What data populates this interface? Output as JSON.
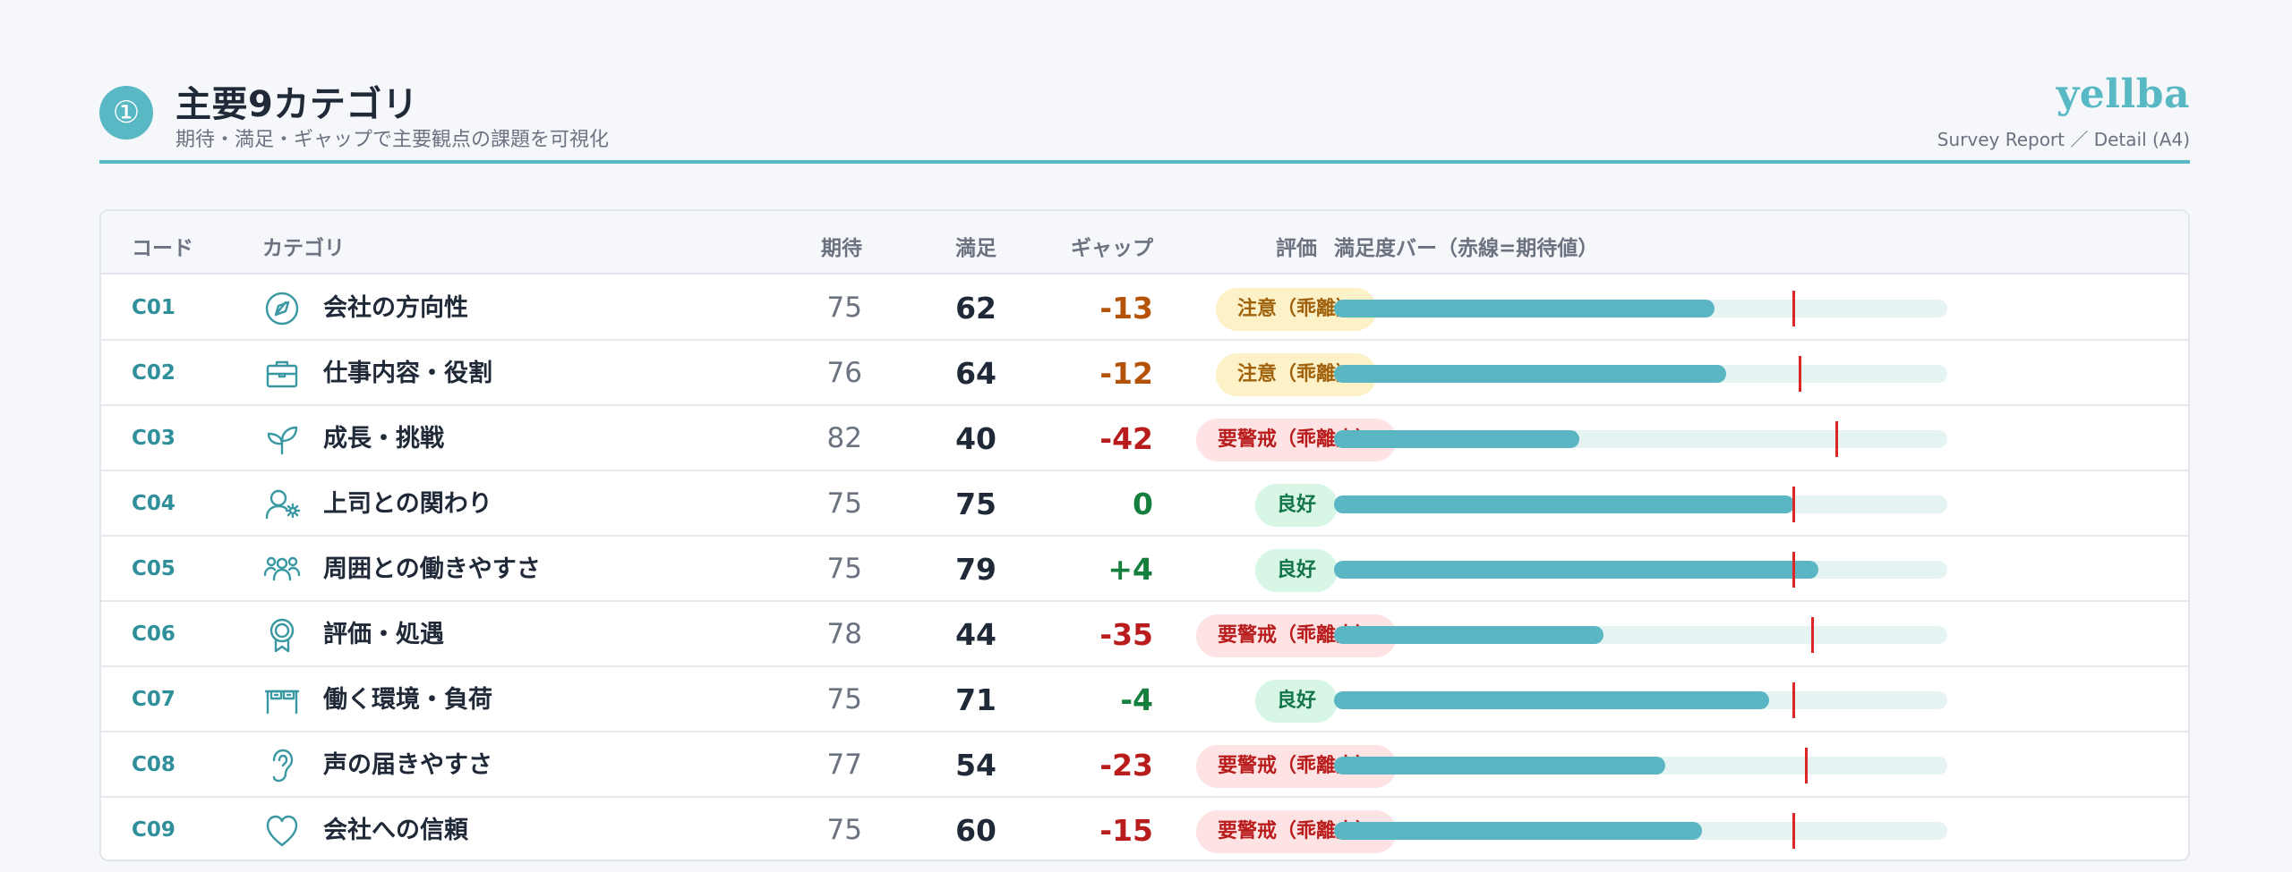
{
  "header": {
    "badge": "①",
    "title": "主要9カテゴリ",
    "subtitle": "期待・満足・ギャップで主要観点の課題を可視化",
    "brand": "yellba",
    "report_meta": "Survey Report ／ Detail (A4)"
  },
  "table": {
    "columns": {
      "code": "コード",
      "category": "カテゴリ",
      "expectation": "期待",
      "satisfaction": "満足",
      "gap": "ギャップ",
      "rating": "評価",
      "bar": "満足度バー（赤線=期待値）"
    },
    "rows": [
      {
        "code": "C01",
        "icon": "compass-icon",
        "category": "会社の方向性",
        "expectation": "75",
        "satisfaction": "62",
        "gap": "-13",
        "gap_color": "#b45309",
        "rating": "注意（乖離）",
        "rating_level": "warn",
        "satisfaction_pct": 62,
        "expectation_pct": 75
      },
      {
        "code": "C02",
        "icon": "briefcase-icon",
        "category": "仕事内容・役割",
        "expectation": "76",
        "satisfaction": "64",
        "gap": "-12",
        "gap_color": "#b45309",
        "rating": "注意（乖離）",
        "rating_level": "warn",
        "satisfaction_pct": 64,
        "expectation_pct": 76
      },
      {
        "code": "C03",
        "icon": "sprout-icon",
        "category": "成長・挑戦",
        "expectation": "82",
        "satisfaction": "40",
        "gap": "-42",
        "gap_color": "#b91c1c",
        "rating": "要警戒（乖離大）",
        "rating_level": "danger",
        "satisfaction_pct": 40,
        "expectation_pct": 82
      },
      {
        "code": "C04",
        "icon": "user-gear-icon",
        "category": "上司との関わり",
        "expectation": "75",
        "satisfaction": "75",
        "gap": "0",
        "gap_color": "#15803d",
        "rating": "良好",
        "rating_level": "good",
        "satisfaction_pct": 75,
        "expectation_pct": 75
      },
      {
        "code": "C05",
        "icon": "team-icon",
        "category": "周囲との働きやすさ",
        "expectation": "75",
        "satisfaction": "79",
        "gap": "+4",
        "gap_color": "#15803d",
        "rating": "良好",
        "rating_level": "good",
        "satisfaction_pct": 79,
        "expectation_pct": 75
      },
      {
        "code": "C06",
        "icon": "award-icon",
        "category": "評価・処遇",
        "expectation": "78",
        "satisfaction": "44",
        "gap": "-35",
        "gap_color": "#b91c1c",
        "rating": "要警戒（乖離大）",
        "rating_level": "danger",
        "satisfaction_pct": 44,
        "expectation_pct": 78
      },
      {
        "code": "C07",
        "icon": "desk-icon",
        "category": "働く環境・負荷",
        "expectation": "75",
        "satisfaction": "71",
        "gap": "-4",
        "gap_color": "#15803d",
        "rating": "良好",
        "rating_level": "good",
        "satisfaction_pct": 71,
        "expectation_pct": 75
      },
      {
        "code": "C08",
        "icon": "ear-icon",
        "category": "声の届きやすさ",
        "expectation": "77",
        "satisfaction": "54",
        "gap": "-23",
        "gap_color": "#b91c1c",
        "rating": "要警戒（乖離大）",
        "rating_level": "danger",
        "satisfaction_pct": 54,
        "expectation_pct": 77
      },
      {
        "code": "C09",
        "icon": "heart-icon",
        "category": "会社への信頼",
        "expectation": "75",
        "satisfaction": "60",
        "gap": "-15",
        "gap_color": "#b91c1c",
        "rating": "要警戒（乖離大）",
        "rating_level": "danger",
        "satisfaction_pct": 60,
        "expectation_pct": 75
      }
    ]
  }
}
